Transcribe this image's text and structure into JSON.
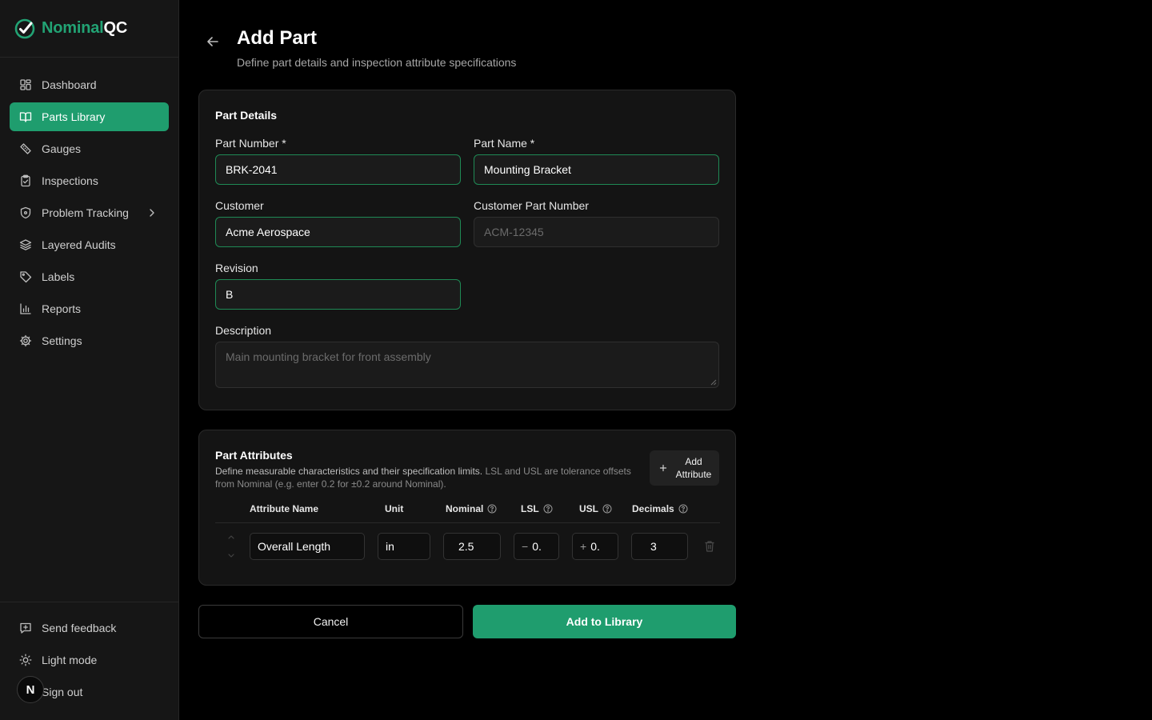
{
  "brand": {
    "part1": "Nominal",
    "part2": "QC"
  },
  "colors": {
    "accent": "#1f9d6e",
    "brand_green": "#22a374",
    "valid_border": "#1f8a55"
  },
  "sidebar": {
    "items": [
      {
        "label": "Dashboard",
        "icon": "dashboard-icon"
      },
      {
        "label": "Parts Library",
        "icon": "book-icon",
        "active": true
      },
      {
        "label": "Gauges",
        "icon": "ruler-icon"
      },
      {
        "label": "Inspections",
        "icon": "clipboard-check-icon"
      },
      {
        "label": "Problem Tracking",
        "icon": "shield-icon",
        "has_submenu": true
      },
      {
        "label": "Layered Audits",
        "icon": "layers-icon"
      },
      {
        "label": "Labels",
        "icon": "tag-icon"
      },
      {
        "label": "Reports",
        "icon": "bar-chart-icon"
      },
      {
        "label": "Settings",
        "icon": "gear-icon"
      }
    ],
    "bottom": [
      {
        "label": "Send feedback",
        "icon": "feedback-icon"
      },
      {
        "label": "Light mode",
        "icon": "sun-icon"
      },
      {
        "label": "Sign out",
        "icon": "sign-out-icon"
      }
    ],
    "avatar_initial": "N"
  },
  "header": {
    "title": "Add Part",
    "subtitle": "Define part details and inspection attribute specifications"
  },
  "part_details": {
    "title": "Part Details",
    "part_number": {
      "label": "Part Number *",
      "value": "BRK-2041"
    },
    "part_name": {
      "label": "Part Name *",
      "value": "Mounting Bracket"
    },
    "customer": {
      "label": "Customer",
      "value": "Acme Aerospace"
    },
    "customer_part_number": {
      "label": "Customer Part Number",
      "placeholder": "ACM-12345"
    },
    "revision": {
      "label": "Revision",
      "value": "B"
    },
    "description": {
      "label": "Description",
      "placeholder": "Main mounting bracket for front assembly"
    }
  },
  "part_attributes": {
    "title": "Part Attributes",
    "description_main": "Define measurable characteristics and their specification limits.",
    "description_muted": " LSL and USL are tolerance offsets from Nominal (e.g. enter 0.2 for ±0.2 around Nominal).",
    "add_button_label": "Add Attribute",
    "columns": {
      "name": "Attribute Name",
      "unit": "Unit",
      "nominal": "Nominal",
      "lsl": "LSL",
      "usl": "USL",
      "decimals": "Decimals"
    },
    "rows": [
      {
        "name": "Overall Length",
        "unit": "in",
        "nominal": "2.5",
        "lsl_sign": "−",
        "lsl": "0.",
        "usl_sign": "+",
        "usl": "0.",
        "decimals": "3"
      }
    ]
  },
  "actions": {
    "cancel": "Cancel",
    "submit": "Add to Library"
  }
}
